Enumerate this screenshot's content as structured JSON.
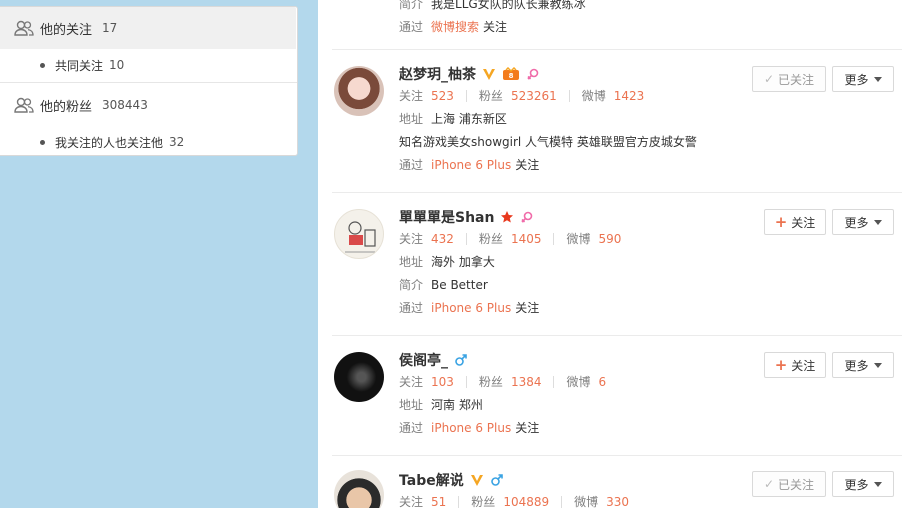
{
  "sidebar": {
    "following": {
      "label": "他的关注",
      "count": "17"
    },
    "common_following": {
      "label": "共同关注",
      "count": "10"
    },
    "fans": {
      "label": "他的粉丝",
      "count": "308443"
    },
    "fans_i_follow": {
      "label": "我关注的人也关注他",
      "count": "32"
    }
  },
  "list": {
    "labels": {
      "follow": "关注",
      "fans": "粉丝",
      "weibo": "微博",
      "address": "地址",
      "intro": "简介",
      "via": "通过",
      "follow_suffix": "关注"
    },
    "buttons": {
      "follow": "关注",
      "followed": "已关注",
      "more": "更多"
    },
    "top_partial": {
      "intro_label": "简介",
      "intro": "我是LLG女队的队长兼教练冰",
      "via_label": "通过",
      "via_source": "微博搜索",
      "via_suffix": "关注"
    },
    "users": [
      {
        "name": "赵梦玥_柚茶",
        "follow": "523",
        "fans": "523261",
        "weibo": "1423",
        "address": "上海 浦东新区",
        "bio": "知名游戏美女showgirl 人气模特 英雄联盟官方皮城女警",
        "via": "iPhone 6 Plus"
      },
      {
        "name": "單單單是Shan",
        "follow": "432",
        "fans": "1405",
        "weibo": "590",
        "address": "海外 加拿大",
        "intro": "Be Better",
        "via": "iPhone 6 Plus"
      },
      {
        "name": "侯阁亭_",
        "follow": "103",
        "fans": "1384",
        "weibo": "6",
        "address": "河南 郑州",
        "via": "iPhone 6 Plus"
      },
      {
        "name": "Tabe解说",
        "follow": "51",
        "fans": "104889",
        "weibo": "330"
      }
    ]
  },
  "colors": {
    "accent": "#eb7350",
    "background": "#b3d8ec",
    "verified": "#f5a623",
    "male": "#3aa3e3",
    "female": "#f06ba9"
  }
}
